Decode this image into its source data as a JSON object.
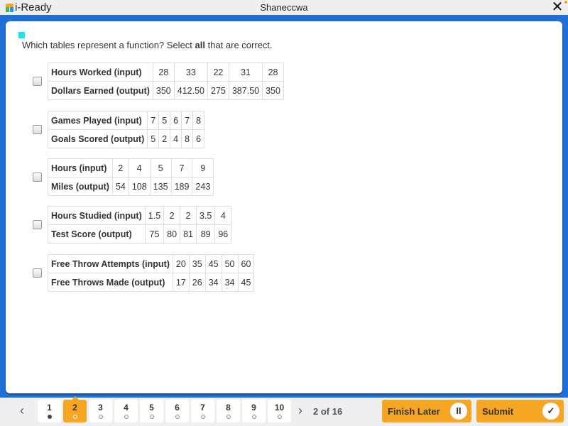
{
  "app": {
    "brand": "i-Ready",
    "window_title": "Shaneccwa",
    "close_symbol": "✕"
  },
  "question": {
    "prefix": "Which tables represent a function? Select ",
    "emphasis": "all",
    "suffix": " that are correct."
  },
  "options": [
    {
      "input_label": "Hours Worked (input)",
      "output_label": "Dollars Earned (output)",
      "inputs": [
        "28",
        "33",
        "22",
        "31",
        "28"
      ],
      "outputs": [
        "350",
        "412.50",
        "275",
        "387.50",
        "350"
      ],
      "checked": false
    },
    {
      "input_label": "Games Played (input)",
      "output_label": "Goals Scored (output)",
      "inputs": [
        "7",
        "5",
        "6",
        "7",
        "8"
      ],
      "outputs": [
        "5",
        "2",
        "4",
        "8",
        "6"
      ],
      "checked": false
    },
    {
      "input_label": "Hours (input)",
      "output_label": "Miles (output)",
      "inputs": [
        "2",
        "4",
        "5",
        "7",
        "9"
      ],
      "outputs": [
        "54",
        "108",
        "135",
        "189",
        "243"
      ],
      "checked": false
    },
    {
      "input_label": "Hours Studied (input)",
      "output_label": "Test Score (output)",
      "inputs": [
        "1.5",
        "2",
        "2",
        "3.5",
        "4"
      ],
      "outputs": [
        "75",
        "80",
        "81",
        "89",
        "96"
      ],
      "checked": false
    },
    {
      "input_label": "Free Throw Attempts (input)",
      "output_label": "Free Throws Made (output)",
      "inputs": [
        "20",
        "35",
        "45",
        "50",
        "60"
      ],
      "outputs": [
        "17",
        "26",
        "34",
        "34",
        "45"
      ],
      "checked": false
    }
  ],
  "nav": {
    "prev_symbol": "‹",
    "next_symbol": "›",
    "pages": [
      {
        "label": "1",
        "status": "answered"
      },
      {
        "label": "2",
        "status": "current"
      },
      {
        "label": "3",
        "status": "unanswered"
      },
      {
        "label": "4",
        "status": "unanswered"
      },
      {
        "label": "5",
        "status": "unanswered"
      },
      {
        "label": "6",
        "status": "unanswered"
      },
      {
        "label": "7",
        "status": "unanswered"
      },
      {
        "label": "8",
        "status": "unanswered"
      },
      {
        "label": "9",
        "status": "unanswered"
      },
      {
        "label": "10",
        "status": "unanswered"
      }
    ],
    "counter": "2 of 16",
    "finish_later_label": "Finish Later",
    "finish_later_icon": "II",
    "submit_label": "Submit",
    "submit_icon": "✓"
  },
  "colors": {
    "frame_blue": "#1f6fd6",
    "accent_orange": "#f6a623",
    "marker_cyan": "#10e8f0"
  }
}
